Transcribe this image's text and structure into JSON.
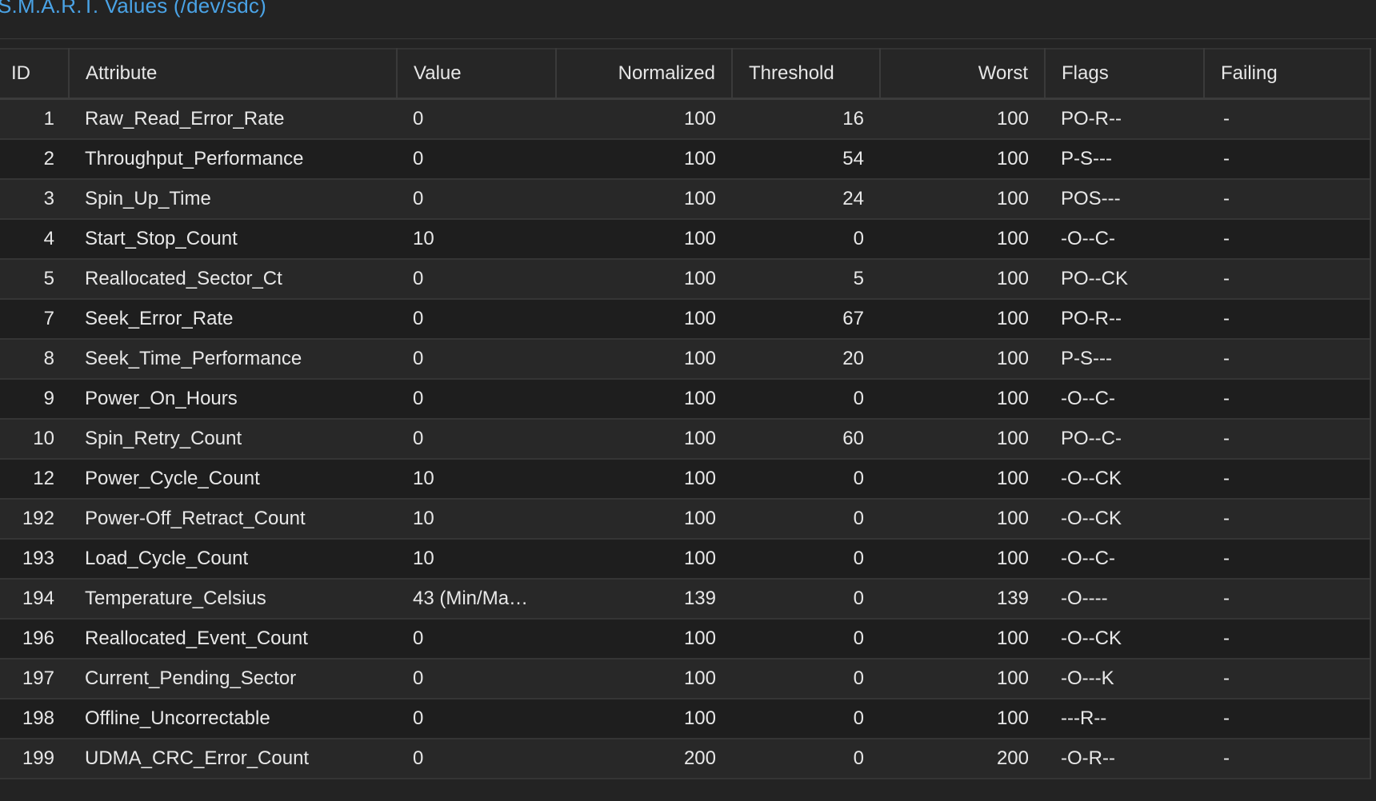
{
  "section": {
    "title": "S.M.A.R.T. Values (/dev/sdc)"
  },
  "table": {
    "headers": {
      "id": "ID",
      "attribute": "Attribute",
      "value": "Value",
      "normalized": "Normalized",
      "threshold": "Threshold",
      "worst": "Worst",
      "flags": "Flags",
      "failing": "Failing"
    },
    "rows": [
      {
        "id": "1",
        "attribute": "Raw_Read_Error_Rate",
        "value": "0",
        "normalized": "100",
        "threshold": "16",
        "worst": "100",
        "flags": "PO-R--",
        "failing": "-"
      },
      {
        "id": "2",
        "attribute": "Throughput_Performance",
        "value": "0",
        "normalized": "100",
        "threshold": "54",
        "worst": "100",
        "flags": "P-S---",
        "failing": "-"
      },
      {
        "id": "3",
        "attribute": "Spin_Up_Time",
        "value": "0",
        "normalized": "100",
        "threshold": "24",
        "worst": "100",
        "flags": "POS---",
        "failing": "-"
      },
      {
        "id": "4",
        "attribute": "Start_Stop_Count",
        "value": "10",
        "normalized": "100",
        "threshold": "0",
        "worst": "100",
        "flags": "-O--C-",
        "failing": "-"
      },
      {
        "id": "5",
        "attribute": "Reallocated_Sector_Ct",
        "value": "0",
        "normalized": "100",
        "threshold": "5",
        "worst": "100",
        "flags": "PO--CK",
        "failing": "-"
      },
      {
        "id": "7",
        "attribute": "Seek_Error_Rate",
        "value": "0",
        "normalized": "100",
        "threshold": "67",
        "worst": "100",
        "flags": "PO-R--",
        "failing": "-"
      },
      {
        "id": "8",
        "attribute": "Seek_Time_Performance",
        "value": "0",
        "normalized": "100",
        "threshold": "20",
        "worst": "100",
        "flags": "P-S---",
        "failing": "-"
      },
      {
        "id": "9",
        "attribute": "Power_On_Hours",
        "value": "0",
        "normalized": "100",
        "threshold": "0",
        "worst": "100",
        "flags": "-O--C-",
        "failing": "-"
      },
      {
        "id": "10",
        "attribute": "Spin_Retry_Count",
        "value": "0",
        "normalized": "100",
        "threshold": "60",
        "worst": "100",
        "flags": "PO--C-",
        "failing": "-"
      },
      {
        "id": "12",
        "attribute": "Power_Cycle_Count",
        "value": "10",
        "normalized": "100",
        "threshold": "0",
        "worst": "100",
        "flags": "-O--CK",
        "failing": "-"
      },
      {
        "id": "192",
        "attribute": "Power-Off_Retract_Count",
        "value": "10",
        "normalized": "100",
        "threshold": "0",
        "worst": "100",
        "flags": "-O--CK",
        "failing": "-"
      },
      {
        "id": "193",
        "attribute": "Load_Cycle_Count",
        "value": "10",
        "normalized": "100",
        "threshold": "0",
        "worst": "100",
        "flags": "-O--C-",
        "failing": "-"
      },
      {
        "id": "194",
        "attribute": "Temperature_Celsius",
        "value": "43 (Min/Ma…",
        "normalized": "139",
        "threshold": "0",
        "worst": "139",
        "flags": "-O----",
        "failing": "-"
      },
      {
        "id": "196",
        "attribute": "Reallocated_Event_Count",
        "value": "0",
        "normalized": "100",
        "threshold": "0",
        "worst": "100",
        "flags": "-O--CK",
        "failing": "-"
      },
      {
        "id": "197",
        "attribute": "Current_Pending_Sector",
        "value": "0",
        "normalized": "100",
        "threshold": "0",
        "worst": "100",
        "flags": "-O---K",
        "failing": "-"
      },
      {
        "id": "198",
        "attribute": "Offline_Uncorrectable",
        "value": "0",
        "normalized": "100",
        "threshold": "0",
        "worst": "100",
        "flags": "---R--",
        "failing": "-"
      },
      {
        "id": "199",
        "attribute": "UDMA_CRC_Error_Count",
        "value": "0",
        "normalized": "200",
        "threshold": "0",
        "worst": "200",
        "flags": "-O-R--",
        "failing": "-"
      }
    ]
  },
  "colors": {
    "accent": "#4aa3e6",
    "background": "#232323",
    "row_odd": "#282828",
    "row_even": "#1e1e1e"
  }
}
